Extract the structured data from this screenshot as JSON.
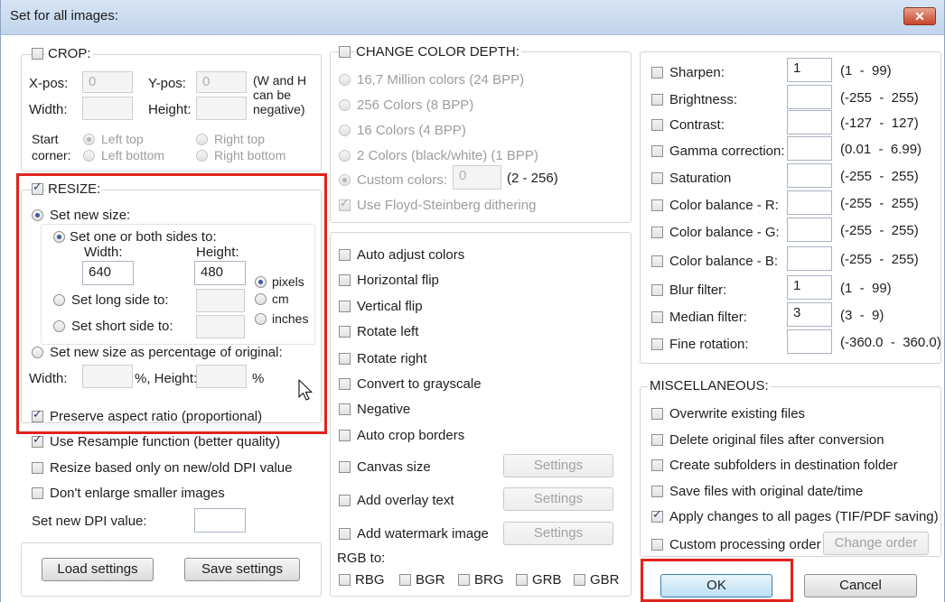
{
  "window": {
    "title": "Set for all images:",
    "close_label": "✕"
  },
  "crop": {
    "label": "CROP:",
    "xpos_label": "X-pos:",
    "xpos_value": "0",
    "ypos_label": "Y-pos:",
    "ypos_value": "0",
    "wh_note_1": "(W and H",
    "wh_note_2": "can be",
    "wh_note_3": "negative)",
    "width_label": "Width:",
    "height_label": "Height:",
    "start_corner_1": "Start",
    "start_corner_2": "corner:",
    "left_top": "Left top",
    "right_top": "Right top",
    "left_bottom": "Left bottom",
    "right_bottom": "Right bottom"
  },
  "resize": {
    "label": "RESIZE:",
    "set_new_size": "Set new size:",
    "set_one_or_both": "Set one or both sides to:",
    "width_label": "Width:",
    "height_label": "Height:",
    "width_value": "640",
    "height_value": "480",
    "unit_pixels": "pixels",
    "unit_cm": "cm",
    "unit_inches": "inches",
    "long_side": "Set long side to:",
    "short_side": "Set short side to:",
    "percentage": "Set new size as percentage of original:",
    "pct_width_label": "Width:",
    "pct_sep": "%, Height:",
    "pct_end": "%",
    "preserve_aspect": "Preserve aspect ratio (proportional)"
  },
  "resize_options": {
    "use_resample": "Use Resample function (better quality)",
    "dpi_only": "Resize based only on new/old DPI value",
    "dont_enlarge": "Don't enlarge smaller images",
    "set_dpi": "Set new DPI value:"
  },
  "buttons": {
    "load": "Load settings",
    "save": "Save settings",
    "ok": "OK",
    "cancel": "Cancel"
  },
  "color_depth": {
    "label": "CHANGE COLOR DEPTH:",
    "options": [
      "16,7 Million colors (24 BPP)",
      "256 Colors (8 BPP)",
      "16 Colors (4 BPP)",
      "2 Colors (black/white) (1 BPP)"
    ],
    "custom_label": "Custom colors:",
    "custom_value": "0",
    "custom_range": "(2 - 256)",
    "dithering": "Use Floyd-Steinberg dithering"
  },
  "transforms": {
    "items": [
      "Auto adjust colors",
      "Horizontal flip",
      "Vertical flip",
      "Rotate left",
      "Rotate right",
      "Convert to grayscale",
      "Negative",
      "Auto crop borders"
    ],
    "canvas_size": "Canvas size",
    "overlay_text": "Add overlay text",
    "watermark": "Add watermark image",
    "settings_label": "Settings",
    "rgb_to": "RGB to:",
    "rgb_options": [
      "RBG",
      "BGR",
      "BRG",
      "GRB",
      "GBR"
    ]
  },
  "adjustments": [
    {
      "label": "Sharpen:",
      "value": "1",
      "range": "(1  -  99)"
    },
    {
      "label": "Brightness:",
      "value": "",
      "range": "(-255  -  255)"
    },
    {
      "label": "Contrast:",
      "value": "",
      "range": "(-127  -  127)"
    },
    {
      "label": "Gamma correction:",
      "value": "",
      "range": "(0.01  -  6.99)"
    },
    {
      "label": "Saturation",
      "value": "",
      "range": "(-255  -  255)"
    },
    {
      "label": "Color balance - R:",
      "value": "",
      "range": "(-255  -  255)"
    },
    {
      "label": "Color balance - G:",
      "value": "",
      "range": "(-255  -  255)"
    },
    {
      "label": "Color balance - B:",
      "value": "",
      "range": "(-255  -  255)"
    },
    {
      "label": "Blur filter:",
      "value": "1",
      "range": "(1  -  99)"
    },
    {
      "label": "Median filter:",
      "value": "3",
      "range": "(3  -  9)"
    },
    {
      "label": "Fine rotation:",
      "value": "",
      "range": "(-360.0  -  360.0)"
    }
  ],
  "misc": {
    "label": "MISCELLANEOUS:",
    "items": [
      "Overwrite existing files",
      "Delete original files after conversion",
      "Create subfolders in destination folder",
      "Save files with original date/time",
      "Apply changes to all pages (TIF/PDF saving)"
    ],
    "custom_order": "Custom processing order",
    "change_order": "Change order"
  },
  "colors": {
    "highlight": "#e0231c",
    "titlebar": "#c9dbf0",
    "close": "#c8452b"
  }
}
